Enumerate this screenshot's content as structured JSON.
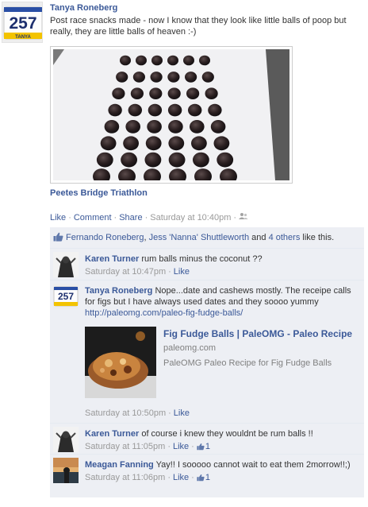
{
  "post": {
    "author": "Tanya Roneberg",
    "avatar_bib_number": "257",
    "avatar_bib_name": "TANYA",
    "text": "Post race snacks made - now I know that they look like little balls of poop but really, they are little balls of heaven :-)",
    "album_title": "Peetes Bridge Triathlon",
    "actions": {
      "like": "Like",
      "comment": "Comment",
      "share": "Share",
      "timestamp": "Saturday at 10:40pm"
    },
    "privacy_icon": "friends-icon"
  },
  "likes": {
    "user1": "Fernando Roneberg",
    "comma": ",",
    "user2": "Jess 'Nanna' Shuttleworth",
    "and": "and",
    "others": "4 others",
    "suffix": "like this."
  },
  "comments": [
    {
      "author": "Karen Turner",
      "text": "rum balls minus the coconut ??",
      "timestamp": "Saturday at 10:47pm",
      "like": "Like"
    },
    {
      "author": "Tanya Roneberg",
      "text": "Nope...date and cashews mostly. The receipe calls for figs but I have always used dates and they soooo yummy",
      "link": "http://paleomg.com/paleo-fig-fudge-balls/",
      "preview": {
        "title": "Fig Fudge Balls | PaleOMG - Paleo Recipe",
        "domain": "paleomg.com",
        "description": "PaleOMG Paleo Recipe for Fig Fudge Balls"
      },
      "timestamp": "Saturday at 10:50pm",
      "like": "Like"
    },
    {
      "author": "Karen Turner",
      "text": "of course i knew they wouldnt be rum balls !!",
      "timestamp": "Saturday at 11:05pm",
      "like": "Like",
      "like_count": "1"
    },
    {
      "author": "Meagan Fanning",
      "text": "Yay!! I sooooo cannot wait to eat them 2morrow!!;)",
      "timestamp": "Saturday at 11:06pm",
      "like": "Like",
      "like_count": "1"
    }
  ],
  "colors": {
    "link": "#3b5998",
    "comment_bg": "#edeff4",
    "muted": "#999999"
  }
}
